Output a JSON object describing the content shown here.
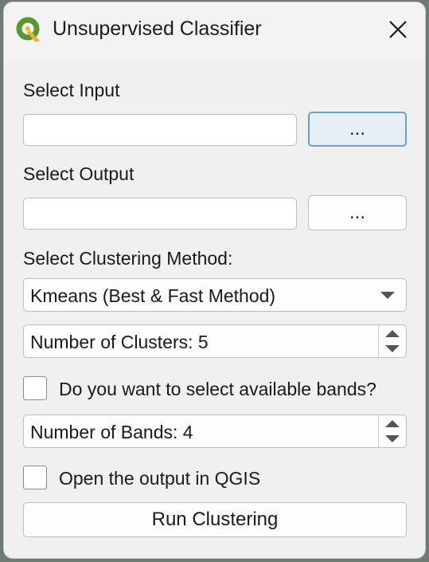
{
  "window": {
    "title": "Unsupervised Classifier"
  },
  "input": {
    "label": "Select Input",
    "value": "",
    "browse_label": "..."
  },
  "output": {
    "label": "Select Output",
    "value": "",
    "browse_label": "..."
  },
  "clustering": {
    "label": "Select Clustering Method:",
    "selected": "Kmeans (Best & Fast Method)"
  },
  "clusters": {
    "text": "Number of Clusters: 5"
  },
  "bands_checkbox": {
    "label": "Do you want to select available bands?",
    "checked": false
  },
  "bands": {
    "text": "Number of Bands: 4"
  },
  "open_checkbox": {
    "label": "Open the output in QGIS",
    "checked": false
  },
  "run": {
    "label": "Run Clustering"
  },
  "colors": {
    "qgis_green": "#589632",
    "qgis_yellow": "#f0b42b",
    "focus_border": "#6e9ed1"
  },
  "icons": {
    "logo": "qgis-logo-icon",
    "close": "close-icon",
    "dropdown": "chevron-down-icon"
  }
}
